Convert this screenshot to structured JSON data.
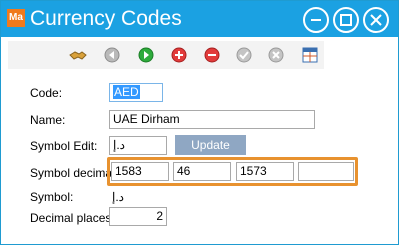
{
  "window": {
    "logo_text": "Ma",
    "title": "Currency Codes",
    "accent": "#1ba1e2",
    "controls": [
      "minimize-icon",
      "maximize-icon",
      "close-icon"
    ]
  },
  "toolbar": {
    "icons": [
      "handshake-icon",
      "back-icon",
      "forward-icon",
      "add-icon",
      "remove-icon",
      "confirm-icon",
      "cancel-icon",
      "table-icon"
    ]
  },
  "form": {
    "code_label": "Code:",
    "code_value": "AED",
    "name_label": "Name:",
    "name_value": "UAE Dirham",
    "symbol_edit_label": "Symbol Edit:",
    "symbol_edit_value": "د.إ",
    "update_label": "Update",
    "symbol_decimal_label": "Symbol decimal:",
    "symbol_decimals": [
      "1583",
      "46",
      "1573",
      ""
    ],
    "symbol_label": "Symbol:",
    "symbol_value": "د.إ",
    "decimal_places_label": "Decimal places:",
    "decimal_places_value": "2"
  },
  "colors": {
    "highlight": "#e8922f",
    "update_button": "#8fa7c3",
    "selection": "#3399ff"
  }
}
